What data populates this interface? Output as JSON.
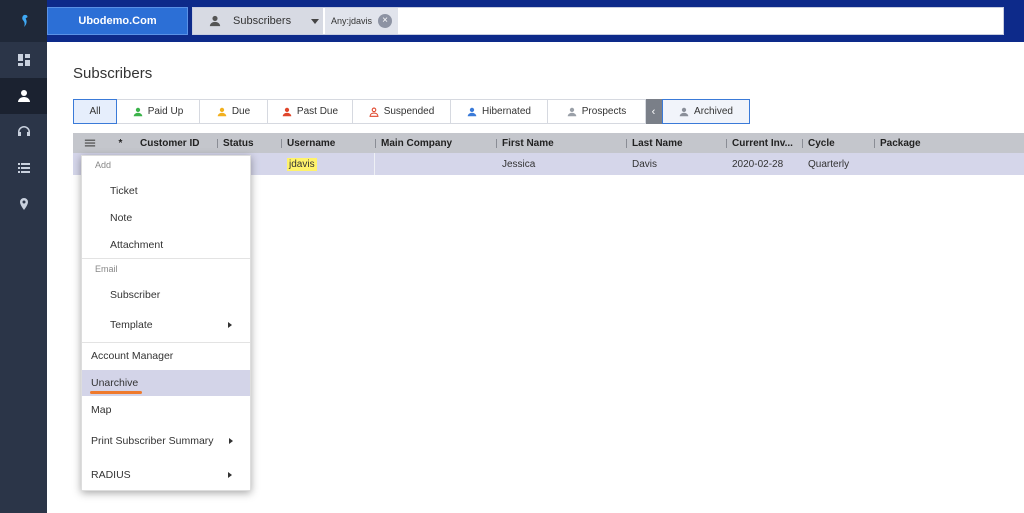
{
  "sidebar": {
    "items": [
      {
        "name": "dashboard",
        "icon": "dashboard-icon"
      },
      {
        "name": "subscribers",
        "icon": "user-icon",
        "active": true
      },
      {
        "name": "support",
        "icon": "headset-icon"
      },
      {
        "name": "lists",
        "icon": "list-icon"
      },
      {
        "name": "map",
        "icon": "map-pin-icon"
      }
    ]
  },
  "topbar": {
    "brand": "Ubodemo.Com",
    "scope": "Subscribers",
    "chip": "Any:jdavis",
    "search_value": ""
  },
  "page": {
    "title": "Subscribers"
  },
  "tabs": [
    {
      "label": "All",
      "active": true
    },
    {
      "label": "Paid Up",
      "color": "#3bb34a"
    },
    {
      "label": "Due",
      "color": "#f2b01e"
    },
    {
      "label": "Past Due",
      "color": "#e0462b"
    },
    {
      "label": "Suspended",
      "color": "#e0462b"
    },
    {
      "label": "Hibernated",
      "color": "#3a7ad8"
    },
    {
      "label": "Prospects",
      "color": "#9aa0a8"
    },
    {
      "label": "‹"
    },
    {
      "label": "Archived",
      "color": "#8a8f99",
      "selected": true
    }
  ],
  "grid": {
    "columns": [
      "",
      "*",
      "Customer ID",
      "Status",
      "Username",
      "Main Company",
      "First Name",
      "Last Name",
      "Current Inv...",
      "Cycle",
      "Package"
    ],
    "rows": [
      {
        "customer_id": "",
        "status": "",
        "username": "jdavis",
        "main_company": "",
        "first_name": "Jessica",
        "last_name": "Davis",
        "current_inv": "2020-02-28",
        "cycle": "Quarterly",
        "package": ""
      }
    ]
  },
  "context_menu": {
    "add_label": "Add",
    "ticket": "Ticket",
    "note": "Note",
    "attachment": "Attachment",
    "email_label": "Email",
    "subscriber": "Subscriber",
    "template": "Template",
    "account_manager": "Account Manager",
    "unarchive": "Unarchive",
    "map": "Map",
    "print_summary": "Print Subscriber Summary",
    "radius": "RADIUS"
  }
}
